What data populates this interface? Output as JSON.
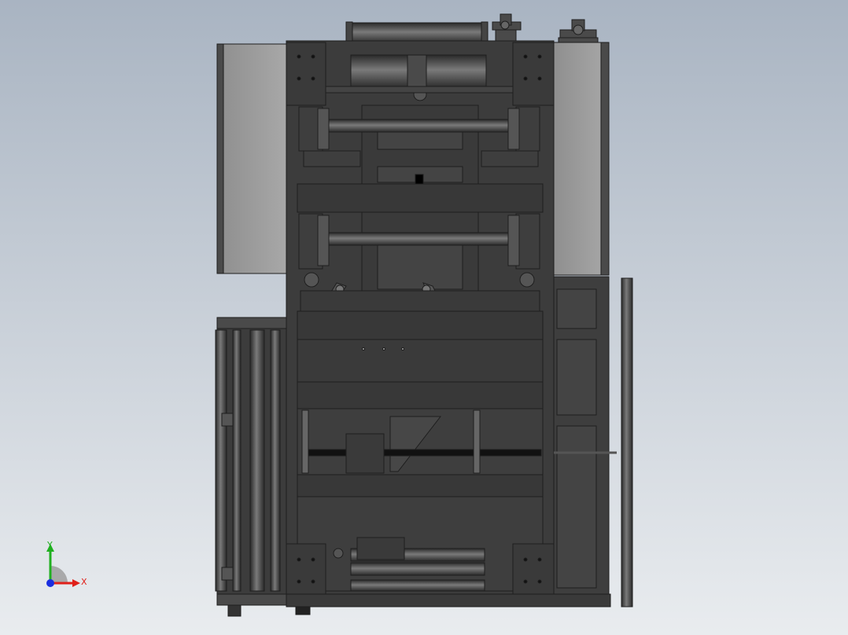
{
  "viewport": {
    "background_top": "#a9b4c2",
    "background_bottom": "#e9ecef"
  },
  "model": {
    "frame_color": "#3c3c3c",
    "panel_color": "#a0a0a0",
    "edge_color": "#1e1e1e",
    "roller_color": "#555555",
    "highlight_color": "#6e6e6e"
  },
  "triad": {
    "x_label": "X",
    "y_label": "Y",
    "x_color": "#e0201a",
    "y_color": "#20b020",
    "z_color": "#1a2ee0",
    "x_icon": "x-axis-arrow",
    "y_icon": "y-axis-arrow",
    "z_icon": "z-axis-dot"
  }
}
